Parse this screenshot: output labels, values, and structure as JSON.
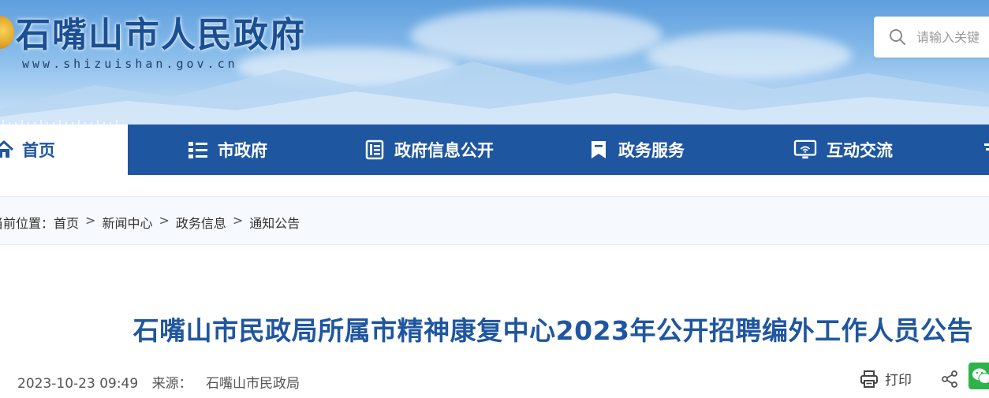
{
  "header": {
    "site_title": "石嘴山市人民政府",
    "site_url": "www.shizuishan.gov.cn",
    "search": {
      "placeholder": "请输入关键"
    }
  },
  "nav": {
    "items": [
      {
        "label": "首页",
        "icon": "home-icon",
        "active": true
      },
      {
        "label": "市政府",
        "icon": "list-icon"
      },
      {
        "label": "政府信息公开",
        "icon": "document-icon"
      },
      {
        "label": "政务服务",
        "icon": "bookmark-icon"
      },
      {
        "label": "互动交流",
        "icon": "monitor-icon"
      }
    ]
  },
  "breadcrumb": {
    "prefix": "当前位置：",
    "items": [
      "首页",
      "新闻中心",
      "政务信息",
      "通知公告"
    ],
    "separator": ">"
  },
  "article": {
    "title": "石嘴山市民政局所属市精神康复中心2023年公开招聘编外工作人员公告",
    "datetime": "2023-10-23 09:49",
    "source_label": "来源：",
    "source": "石嘴山市民政局",
    "print_label": "打印"
  },
  "colors": {
    "nav_bg": "#1f56a0",
    "title_blue": "#1f56a0",
    "wechat_green": "#2db34a"
  }
}
